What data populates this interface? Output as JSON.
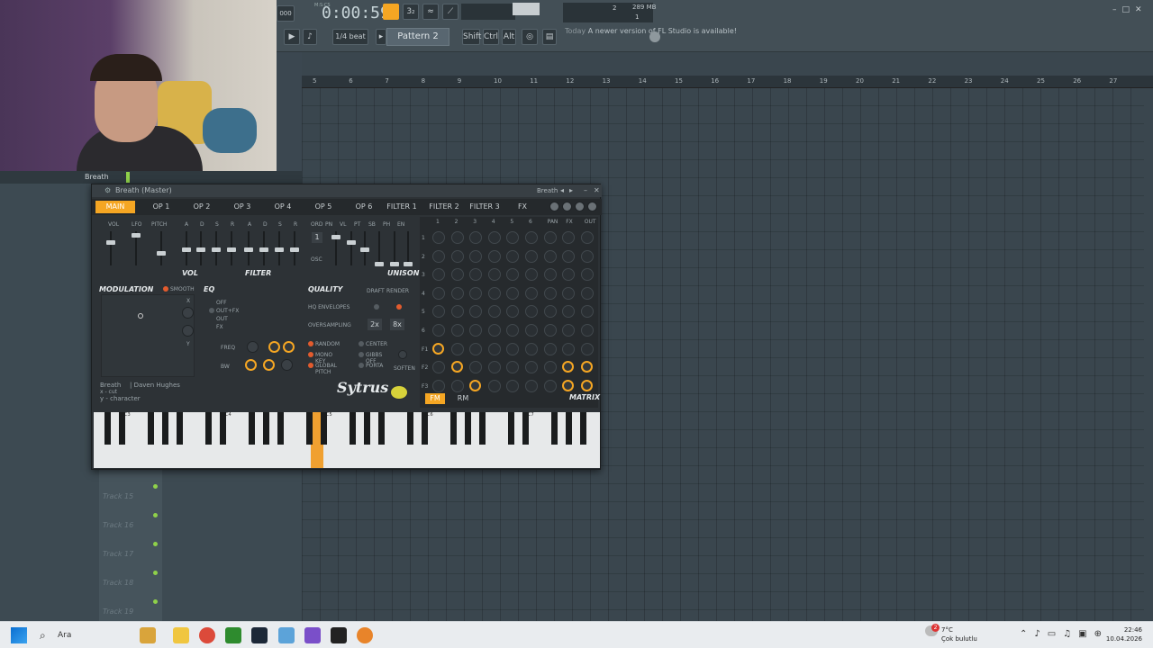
{
  "topbar": {
    "time": "0:00:59",
    "time_unit": "M:S:CS",
    "snap": "1/4 beat",
    "pattern": "Pattern 2",
    "keys": [
      "Shift",
      "Ctrl",
      "Alt"
    ],
    "notice_today": "Today",
    "notice_text": "A newer version of FL Studio is available!",
    "memory": "289 MB",
    "cpu": "2",
    "voices": "1",
    "tempo_field": "000"
  },
  "channel": {
    "name": "Breath"
  },
  "playlist": {
    "ruler": [
      "5",
      "6",
      "7",
      "8",
      "9",
      "10",
      "11",
      "12",
      "13",
      "14",
      "15",
      "16",
      "17",
      "18",
      "19",
      "20",
      "21",
      "22",
      "23",
      "24",
      "25",
      "26",
      "27"
    ],
    "tracks": [
      "Track 15",
      "Track 16",
      "Track 17",
      "Track 18",
      "Track 19"
    ]
  },
  "sytrus": {
    "title": "Breath (Master)",
    "title_right": "Breath",
    "tabs": [
      "MAIN",
      "OP 1",
      "OP 2",
      "OP 3",
      "OP 4",
      "OP 5",
      "OP 6",
      "FILTER 1",
      "FILTER 2",
      "FILTER 3",
      "FX"
    ],
    "vol_labels": [
      "VOL",
      "LFO",
      "PITCH"
    ],
    "adsr": [
      "A",
      "D",
      "S",
      "R",
      "A",
      "D",
      "S",
      "R"
    ],
    "osc_labels": [
      "ORD",
      "PN",
      "VL",
      "PT",
      "SB",
      "PH",
      "EN"
    ],
    "osc_value": "1",
    "osc": "OSC",
    "vol_section": "VOL",
    "filter_section": "FILTER",
    "unison": "UNISON",
    "modulation": "MODULATION",
    "smooth": "SMOOTH",
    "mod_x": "X",
    "mod_y": "Y",
    "eq": "EQ",
    "eq_opts": [
      "OFF",
      "OUT+FX",
      "OUT",
      "FX"
    ],
    "freq": "FREQ",
    "bw": "BW",
    "quality": "QUALITY",
    "draft": "DRAFT",
    "render": "RENDER",
    "hq_env": "HQ ENVELOPES",
    "oversampling": "OVERSAMPLING",
    "os_vals": [
      "2x",
      "8x"
    ],
    "opts_left": [
      "RANDOM",
      "MONO KEY",
      "GLOBAL PITCH"
    ],
    "opts_right": [
      "CENTER",
      "GIBBS OFF",
      "PORTA"
    ],
    "soften": "SOFTEN",
    "preset_name": "Breath",
    "preset_author": "| Daven Hughes",
    "preset_x": "x - cut",
    "preset_y": "y - character",
    "logo": "Sytrus",
    "matrix_cols": [
      "1",
      "2",
      "3",
      "4",
      "5",
      "6",
      "PAN",
      "FX",
      "OUT"
    ],
    "matrix_rows": [
      "1",
      "2",
      "3",
      "4",
      "5",
      "6",
      "F1",
      "F2",
      "F3"
    ],
    "fm": "FM",
    "rm": "RM",
    "matrix": "MATRIX",
    "octaves": [
      "C3",
      "C4",
      "C5",
      "C6",
      "C7"
    ]
  },
  "taskbar": {
    "search": "Ara",
    "weather_temp": "7°C",
    "weather_desc": "Çok bulutlu",
    "time": "22:46",
    "date": "10.04.2026",
    "badge": "2"
  },
  "colors": {
    "accent": "#f5a623",
    "bg": "#3a464e",
    "panel": "#2d3236"
  }
}
